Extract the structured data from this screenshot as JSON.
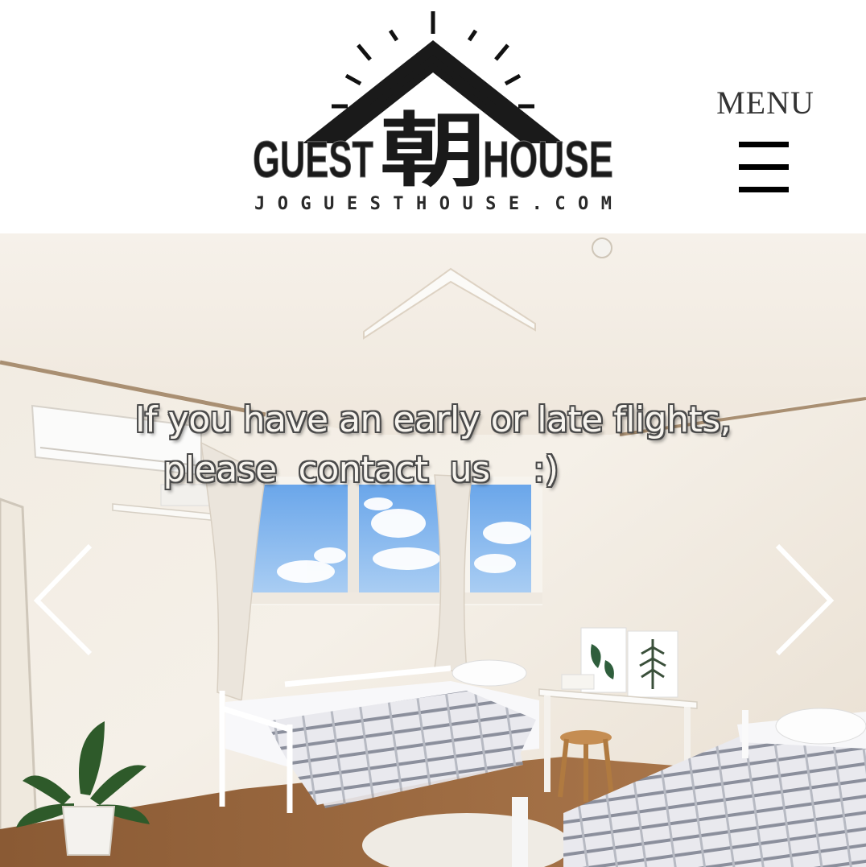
{
  "header": {
    "logo": {
      "word_left": "GUEST",
      "glyph": "朝",
      "word_right": "HOUSE",
      "domain": "JOGUESTHOUSE.COM"
    },
    "menu": {
      "label": "MENU",
      "icon": "hamburger-icon"
    }
  },
  "slideshow": {
    "caption_line1": "If you have an early or late flights,",
    "caption_line2": "please  contact  us    :)",
    "prev_icon": "chevron-left-icon",
    "next_icon": "chevron-right-icon"
  }
}
